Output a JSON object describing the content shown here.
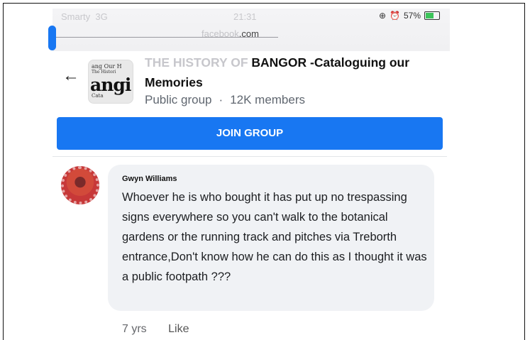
{
  "status_bar": {
    "carrier": "Smarty",
    "network": "3G",
    "time": "21:31",
    "battery": "57%",
    "url_prefix": "facebook",
    "url_suffix": ".com"
  },
  "group": {
    "title_faded": "THE HISTORY OF ",
    "title_bold": "BANGOR -Cataloguing our  Memories",
    "thumb_lines": [
      "ang Our H",
      "The Histori",
      "angi",
      "Cata"
    ],
    "privacy": "Public group",
    "separator": "·",
    "members": "12K members"
  },
  "join_button": "JOIN GROUP",
  "comment": {
    "author": "Gwyn Williams",
    "text": "Whoever he is who bought it has put up no trespassing signs everywhere so you can't walk to the botanical gardens or the running track and pitches via Treborth entrance,Don't know how he can do this as I thought it was a public footpath ???",
    "age": "7 yrs",
    "like_label": "Like"
  },
  "colors": {
    "accent": "#1877f2",
    "bubble_bg": "#f0f2f5",
    "battery_fill": "#3cc45a"
  },
  "icons": {
    "back": "arrow-left-icon",
    "alarm": "alarm-icon",
    "lock": "orientation-lock-icon",
    "battery": "battery-charging-icon"
  }
}
